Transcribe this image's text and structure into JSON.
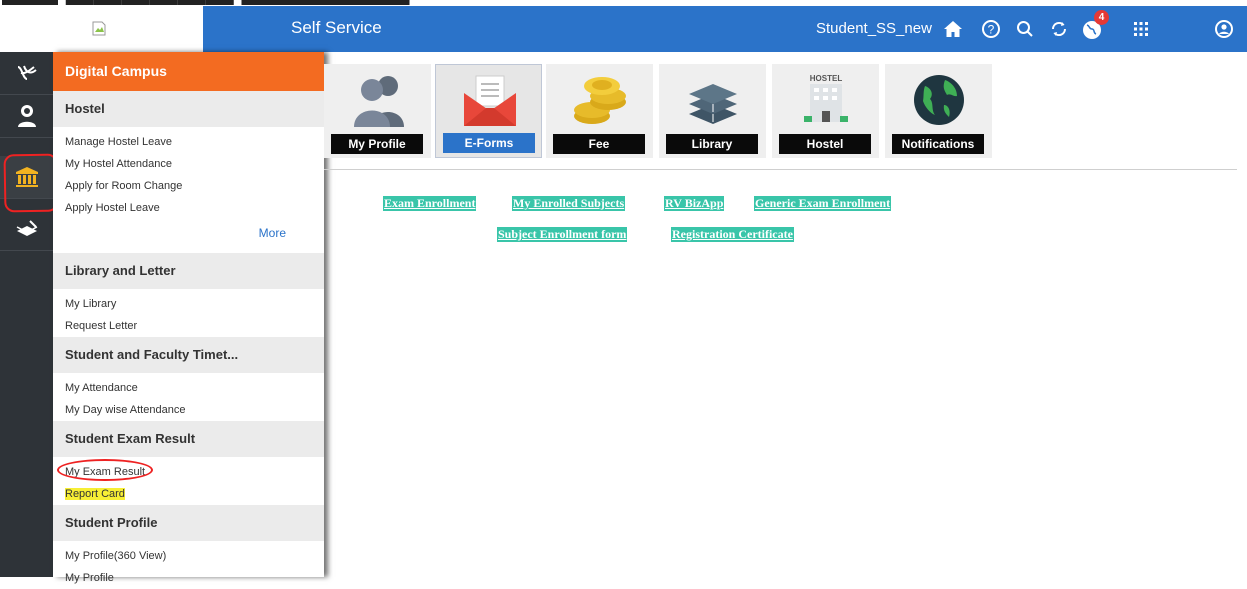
{
  "header": {
    "app_title": "Self Service",
    "user_name": "Student_SS_new",
    "notification_count": "4",
    "icons": [
      "home-icon",
      "help-icon",
      "search-icon",
      "refresh-icon",
      "globe-icon",
      "apps-grid-icon",
      "user-icon"
    ]
  },
  "sidebar": {
    "title": "Digital Campus",
    "sections": [
      {
        "title": "Hostel",
        "items": [
          "Manage Hostel Leave",
          "My Hostel Attendance",
          "Apply for Room Change",
          "Apply Hostel Leave"
        ],
        "more": "More"
      },
      {
        "title": "Library and Letter",
        "items": [
          "My Library",
          "Request Letter"
        ]
      },
      {
        "title": "Student and Faculty Timet...",
        "items": [
          "My Attendance",
          "My Day wise Attendance"
        ]
      },
      {
        "title": "Student Exam Result",
        "items": [
          "My Exam Result",
          "Report Card"
        ]
      },
      {
        "title": "Student Profile",
        "items": [
          "My Profile(360 View)",
          "My Profile"
        ]
      }
    ]
  },
  "tiles": [
    {
      "label": "My Profile"
    },
    {
      "label": "E-Forms"
    },
    {
      "label": "Fee"
    },
    {
      "label": "Library"
    },
    {
      "label": "Hostel",
      "caption": "HOSTEL"
    },
    {
      "label": "Notifications"
    }
  ],
  "eforms": [
    "Exam Enrollment",
    "My Enrolled Subjects",
    "RV BizApp",
    "Generic Exam Enrollment",
    "Subject Enrollment form",
    "Registration Certificate"
  ],
  "colors": {
    "appbar": "#2b73c9",
    "accent": "#f36b21",
    "eform_link_bg": "#39c5a9",
    "rail": "#2e3338"
  }
}
